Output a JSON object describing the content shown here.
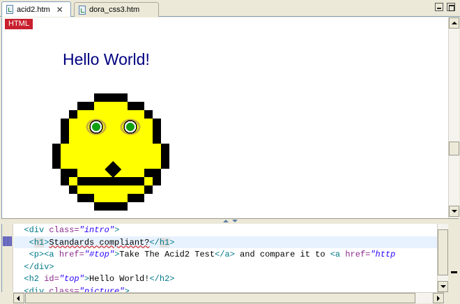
{
  "tabs": [
    {
      "label": "acid2.htm",
      "active": true,
      "close_glyph": "✕"
    },
    {
      "label": "dora_css3.htm",
      "active": false
    }
  ],
  "preview": {
    "badge": "HTML",
    "heading": "Hello World!",
    "colors": {
      "badge_bg": "#c8202e",
      "heading": "#000080",
      "face": "#ffff00",
      "outline": "#000000",
      "iris": "#10a010"
    }
  },
  "source": {
    "lines": [
      {
        "indent": "  ",
        "parts": [
          [
            "tg",
            "<div "
          ],
          [
            "at",
            "class="
          ],
          [
            "vl",
            "\"intro\""
          ],
          [
            "tg",
            ">"
          ]
        ]
      },
      {
        "indent": "   ",
        "parts": [
          [
            "tg",
            "<"
          ],
          [
            "hl",
            "h1"
          ],
          [
            "tg",
            ">"
          ],
          [
            "sq",
            "Standards compliant?"
          ],
          [
            "tg",
            "</"
          ],
          [
            "hl",
            "h1"
          ],
          [
            "tg",
            ">"
          ]
        ]
      },
      {
        "indent": "   ",
        "parts": [
          [
            "tg",
            "<p><a "
          ],
          [
            "at",
            "href="
          ],
          [
            "vl",
            "\"#top\""
          ],
          [
            "tg",
            ">"
          ],
          [
            "tx",
            "Take The Acid2 Test"
          ],
          [
            "tg",
            "</a>"
          ],
          [
            "tx",
            " and compare it to "
          ],
          [
            "tg",
            "<a "
          ],
          [
            "at",
            "href="
          ],
          [
            "vl",
            "\"http"
          ]
        ]
      },
      {
        "indent": "  ",
        "parts": [
          [
            "tg",
            "</div>"
          ]
        ]
      },
      {
        "indent": "  ",
        "parts": [
          [
            "tg",
            "<h2 "
          ],
          [
            "at",
            "id="
          ],
          [
            "vl",
            "\"top\""
          ],
          [
            "tg",
            ">"
          ],
          [
            "tx",
            "Hello World!"
          ],
          [
            "tg",
            "</h2>"
          ]
        ]
      },
      {
        "indent": "  ",
        "parts": [
          [
            "tg",
            "<div "
          ],
          [
            "at",
            "class="
          ],
          [
            "vl",
            "\"picture\""
          ],
          [
            "tg",
            ">"
          ]
        ]
      }
    ]
  },
  "icons": [
    "file-icon",
    "close-icon",
    "minimize-icon",
    "maximize-icon",
    "arrow-up-icon",
    "arrow-down-icon",
    "arrow-left-icon",
    "arrow-right-icon"
  ]
}
